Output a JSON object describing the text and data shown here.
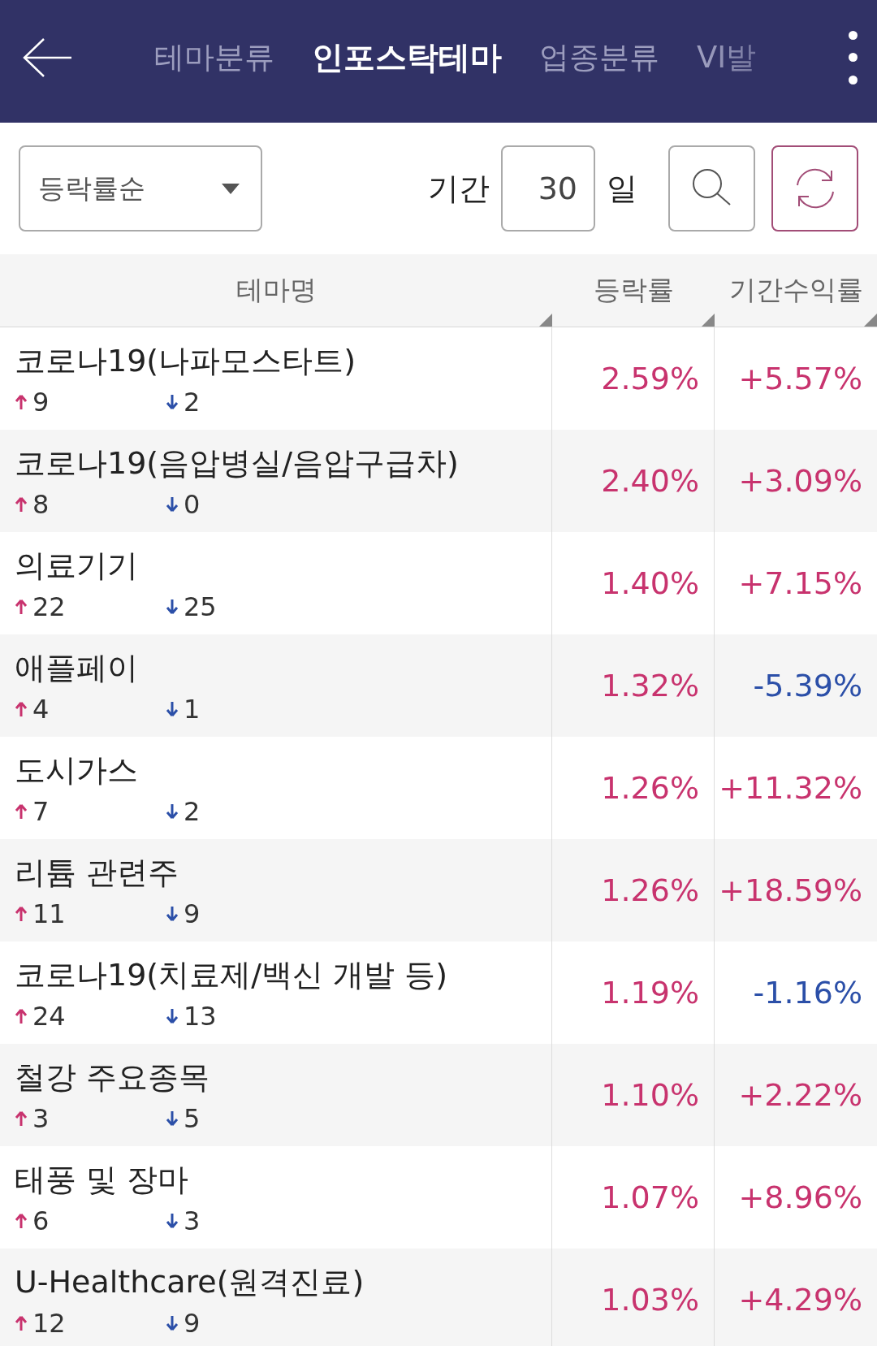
{
  "header": {
    "tabs": [
      {
        "label": "테마분류",
        "selected": false
      },
      {
        "label": "인포스탁테마",
        "selected": true
      },
      {
        "label": "업종분류",
        "selected": false
      },
      {
        "label": "VI발",
        "selected": false
      }
    ]
  },
  "controls": {
    "sort": "등락률순",
    "period_label": "기간",
    "period_value": "30",
    "period_unit": "일"
  },
  "table": {
    "columns": [
      "테마명",
      "등락률",
      "기간수익률"
    ],
    "rows": [
      {
        "name": "코로나19(나파모스타트)",
        "up": "9",
        "down": "2",
        "rate": {
          "text": "2.59%",
          "color": "#c8336e"
        },
        "period": {
          "text": "+5.57%",
          "color": "#c8336e"
        }
      },
      {
        "name": "코로나19(음압병실/음압구급차)",
        "up": "8",
        "down": "0",
        "rate": {
          "text": "2.40%",
          "color": "#c8336e"
        },
        "period": {
          "text": "+3.09%",
          "color": "#c8336e"
        }
      },
      {
        "name": "의료기기",
        "up": "22",
        "down": "25",
        "rate": {
          "text": "1.40%",
          "color": "#c8336e"
        },
        "period": {
          "text": "+7.15%",
          "color": "#c8336e"
        }
      },
      {
        "name": "애플페이",
        "up": "4",
        "down": "1",
        "rate": {
          "text": "1.32%",
          "color": "#c8336e"
        },
        "period": {
          "text": "-5.39%",
          "color": "#2b4fa8"
        }
      },
      {
        "name": "도시가스",
        "up": "7",
        "down": "2",
        "rate": {
          "text": "1.26%",
          "color": "#c8336e"
        },
        "period": {
          "text": "+11.32%",
          "color": "#c8336e"
        }
      },
      {
        "name": "리튬 관련주",
        "up": "11",
        "down": "9",
        "rate": {
          "text": "1.26%",
          "color": "#c8336e"
        },
        "period": {
          "text": "+18.59%",
          "color": "#c8336e"
        }
      },
      {
        "name": "코로나19(치료제/백신 개발 등)",
        "up": "24",
        "down": "13",
        "rate": {
          "text": "1.19%",
          "color": "#c8336e"
        },
        "period": {
          "text": "-1.16%",
          "color": "#2b4fa8"
        }
      },
      {
        "name": "철강 주요종목",
        "up": "3",
        "down": "5",
        "rate": {
          "text": "1.10%",
          "color": "#c8336e"
        },
        "period": {
          "text": "+2.22%",
          "color": "#c8336e"
        }
      },
      {
        "name": "태풍 및 장마",
        "up": "6",
        "down": "3",
        "rate": {
          "text": "1.07%",
          "color": "#c8336e"
        },
        "period": {
          "text": "+8.96%",
          "color": "#c8336e"
        }
      },
      {
        "name": "U-Healthcare(원격진료)",
        "up": "12",
        "down": "9",
        "rate": {
          "text": "1.03%",
          "color": "#c8336e"
        },
        "period": {
          "text": "+4.29%",
          "color": "#c8336e"
        }
      }
    ]
  }
}
